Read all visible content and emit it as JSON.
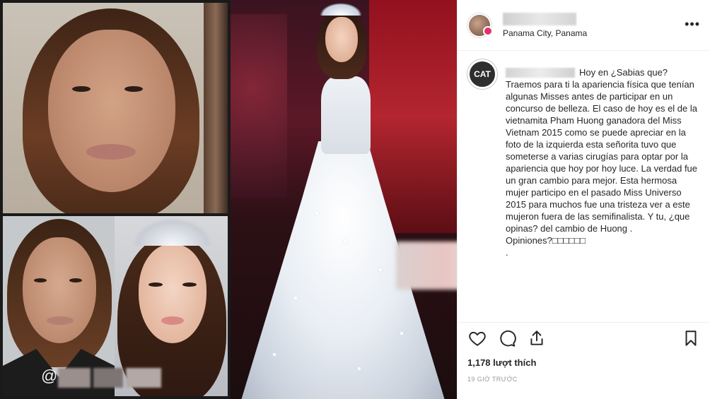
{
  "post": {
    "location": "Panama City, Panama",
    "caption_intro": "Hoy en ¿Sabias que?",
    "caption_body": "Traemos para ti la apariencia física que tenían algunas Misses antes de participar en un concurso de belleza. El caso de hoy es el de la vietnamita Pham Huong ganadora del Miss Vietnam 2015 como se puede apreciar en la foto de la izquierda esta señorita tuvo que someterse a varias cirugías para optar por la apariencia que hoy por hoy luce. La verdad fue un gran cambio para mejor. Esta hermosa mujer participo en el pasado Miss Universo 2015 para muchos fue una tristeza ver a este mujeron fuera de las semifinalista. Y tu, ¿que opinas? del cambio de Huong .",
    "caption_end": "Opiniones?□□□□□□",
    "caption_dot": ".",
    "likes": "1,178 lượt thích",
    "time": "19 GIỜ TRƯỚC",
    "commenter_avatar_text": "CAT"
  },
  "photo": {
    "watermark": "@"
  },
  "icons": {
    "like": "heart-icon",
    "comment": "comment-icon",
    "share": "share-icon",
    "save": "bookmark-icon",
    "more": "more-icon"
  },
  "colors": {
    "text": "#262626",
    "muted": "#999999",
    "border": "#efefef",
    "badge": "#e1306c"
  }
}
